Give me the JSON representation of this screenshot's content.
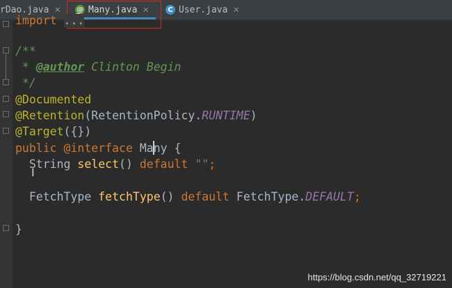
{
  "tabs": [
    {
      "label": "rDao.java",
      "close": "✕",
      "active": false
    },
    {
      "label": "Many.java",
      "close": "✕",
      "active": true,
      "icon": "@"
    },
    {
      "label": "User.java",
      "close": "✕",
      "active": false,
      "icon": "C"
    }
  ],
  "code": {
    "import_kw": "import",
    "import_dots": "...",
    "doc_open": "/**",
    "doc_star": " * ",
    "doc_tag": "@author",
    "doc_author": " Clinton Begin",
    "doc_close": " */",
    "ann_documented": "@Documented",
    "ann_retention": "@Retention",
    "retention_open": "(RetentionPolicy.",
    "retention_const": "RUNTIME",
    "retention_close": ")",
    "ann_target": "@Target",
    "target_args": "({})",
    "decl_public": "public ",
    "decl_interface": "@interface",
    "decl_name": " Many {",
    "m1_type": "  String ",
    "m1_name": "select",
    "m1_parens": "() ",
    "m1_default": "default",
    "m1_space": " ",
    "m1_value": "\"\"",
    "m1_semi": ";",
    "m2_type": "  FetchType ",
    "m2_name": "fetchType",
    "m2_parens": "() ",
    "m2_default": "default",
    "m2_value": " FetchType.",
    "m2_const": "DEFAULT",
    "m2_semi": ";",
    "close_brace": "}"
  },
  "watermark": "https://blog.csdn.net/qq_32719221",
  "colors": {
    "keyword": "#cc7832",
    "annotation": "#bbb529",
    "string": "#6a8759",
    "constant": "#9876aa",
    "doc": "#629755",
    "method": "#ffc66d",
    "accent": "#4a88c7",
    "highlight": "#d62a2a"
  }
}
